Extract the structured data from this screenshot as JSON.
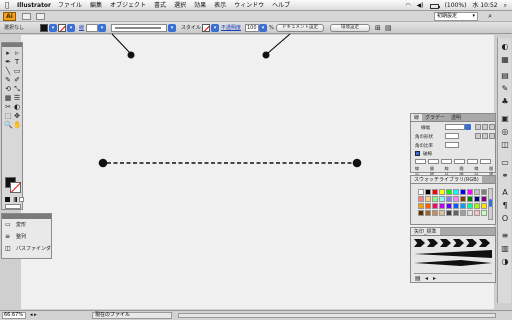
{
  "menubar": {
    "app_name": "Illustrator",
    "items": [
      "ファイル",
      "編集",
      "オブジェクト",
      "書式",
      "選択",
      "効果",
      "表示",
      "ウィンドウ",
      "ヘルプ"
    ],
    "battery": "(100%)",
    "clock": "水 10:52"
  },
  "appbar": {
    "logo": "Ai",
    "workspace": "初期設定"
  },
  "controlbar": {
    "selection_label": "選択なし",
    "stroke_label": "線",
    "style_label": "スタイル",
    "opacity_label": "不透明度",
    "opacity_value": "100",
    "percent": "%",
    "doc_setup_button": "ドキュメント設定",
    "preferences_button": "環境設定"
  },
  "tools": {
    "icons": [
      "▸",
      "▹",
      "✒",
      "T",
      "╲",
      "▭",
      "✎",
      "✐",
      "⟲",
      "⤡",
      "▦",
      "☰",
      "✂",
      "◐",
      "⬚",
      "✥",
      "🔍",
      "✋"
    ]
  },
  "flyout": {
    "items": [
      {
        "icon": "▭",
        "label": "変形"
      },
      {
        "icon": "≡",
        "label": "整列"
      },
      {
        "icon": "◫",
        "label": "パスファインダ"
      }
    ]
  },
  "stroke_panel": {
    "tabs": [
      "線",
      "グラデー",
      "透明"
    ],
    "weight_label": "線幅",
    "cap_label": "角の形状",
    "join_label": "角の比率",
    "dash_label": "破線",
    "dash_fields": [
      "線分",
      "間隔",
      "線分",
      "間隔",
      "線分",
      "間隔"
    ]
  },
  "swatch_panel": {
    "title": "スウォッチライブラリ(RGB)",
    "colors": [
      "#ffffff",
      "#000000",
      "#ff0000",
      "#ffff00",
      "#00ff00",
      "#00ffff",
      "#0000ff",
      "#ff00ff",
      "#c0c0c0",
      "#808080",
      "#ff8080",
      "#ffd080",
      "#80ff80",
      "#80ffff",
      "#8080ff",
      "#ff80ff",
      "#804000",
      "#008000",
      "#000080",
      "#800080",
      "#ffa000",
      "#ff6000",
      "#ff0060",
      "#c000ff",
      "#6000ff",
      "#0060ff",
      "#00a0ff",
      "#00ffa0",
      "#a0ff00",
      "#ffe000",
      "#603000",
      "#a06030",
      "#c09060",
      "#e0c090",
      "#404040",
      "#606060",
      "#a0a0a0",
      "#e0e0e0",
      "#ffc0c0",
      "#c0ffc0"
    ]
  },
  "brush_panel": {
    "tabs": [
      "矢印_標準"
    ]
  },
  "status": {
    "zoom": "66.67%",
    "doc": "現在のファイル"
  }
}
